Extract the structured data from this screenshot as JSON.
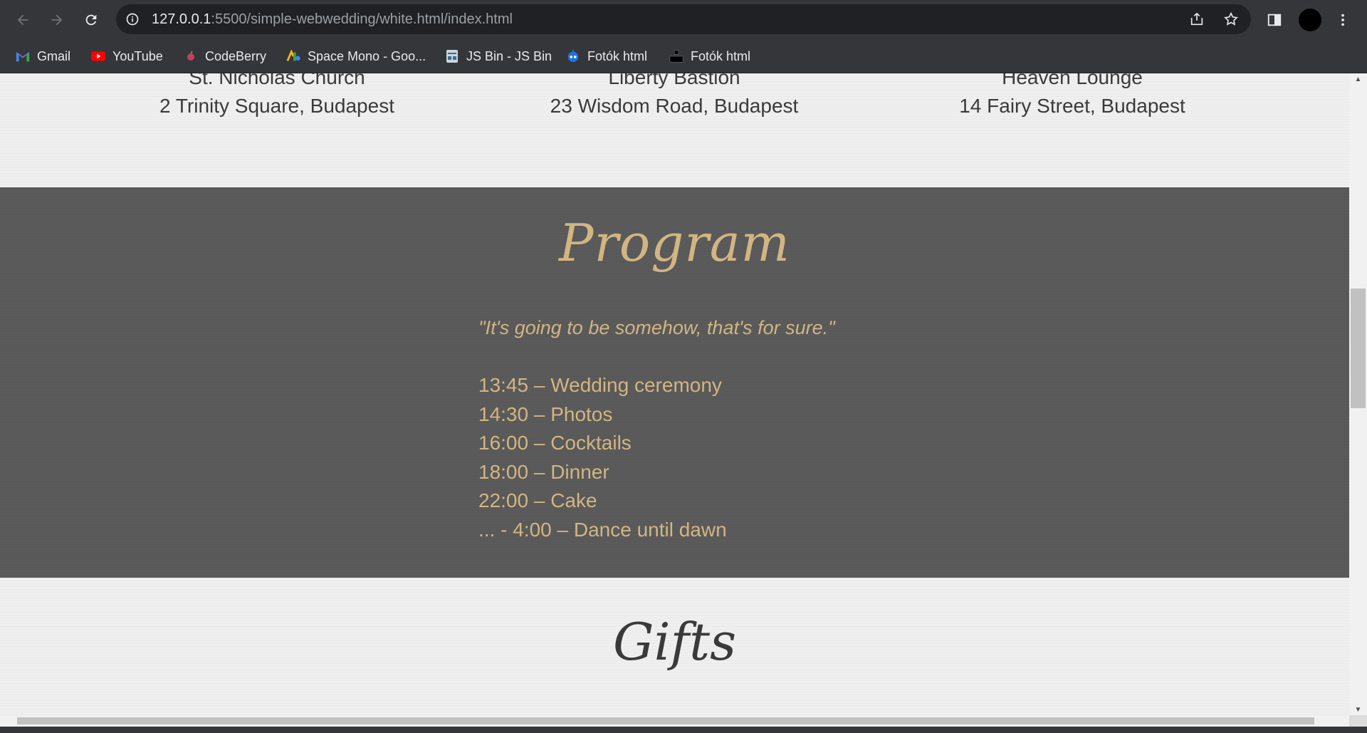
{
  "browser": {
    "url_host": "127.0.0.1",
    "url_path": ":5500/simple-webwedding/white.html/index.html",
    "bookmarks": [
      {
        "label": "Gmail",
        "icon": "gmail-icon"
      },
      {
        "label": "YouTube",
        "icon": "youtube-icon"
      },
      {
        "label": "CodeBerry",
        "icon": "codeberry-icon"
      },
      {
        "label": "Space Mono - Goo...",
        "icon": "google-fonts-icon"
      },
      {
        "label": "JS Bin - JS Bin",
        "icon": "jsbin-icon"
      },
      {
        "label": "Fotók html",
        "icon": "robot-icon"
      },
      {
        "label": "Fotók html",
        "icon": "blocks-icon"
      }
    ]
  },
  "venues": [
    {
      "name": "St. Nicholas Church",
      "address": "2 Trinity Square, Budapest"
    },
    {
      "name": "Liberty Bastion",
      "address": "23 Wisdom Road, Budapest"
    },
    {
      "name": "Heaven Lounge",
      "address": "14 Fairy Street, Budapest"
    }
  ],
  "program": {
    "title": "Program",
    "quote": "\"It's going to be somehow, that's for sure.\"",
    "schedule": [
      "13:45 – Wedding ceremony",
      "14:30 – Photos",
      "16:00 – Cocktails",
      "18:00 – Dinner",
      "22:00 – Cake",
      "... - 4:00 – Dance until dawn"
    ]
  },
  "gifts": {
    "title": "Gifts"
  },
  "colors": {
    "gold": "#d2b582",
    "dark_band": "#595959",
    "paper": "#efefef"
  }
}
